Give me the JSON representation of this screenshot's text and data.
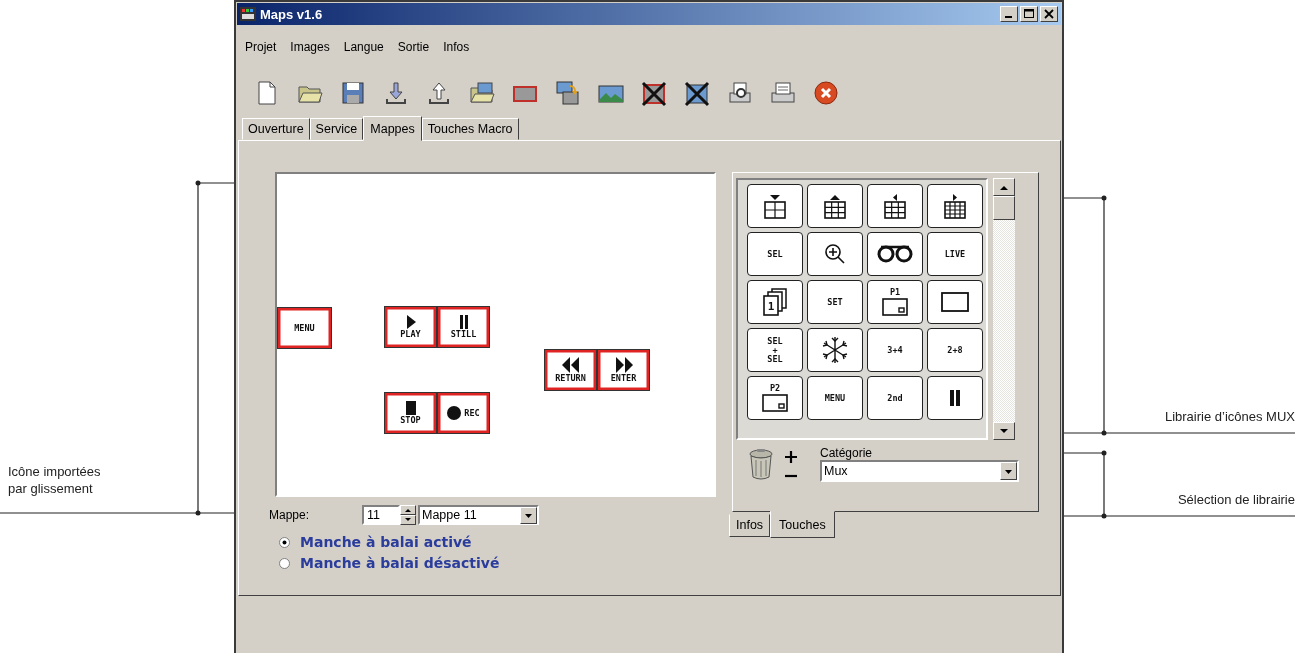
{
  "annotations": {
    "left": [
      "Icône importées par glissement"
    ],
    "right": [
      "Librairie d’icônes MUX",
      "Sélection de librairie"
    ]
  },
  "window": {
    "title": "Maps v1.6"
  },
  "menu": [
    "Projet",
    "Images",
    "Langue",
    "Sortie",
    "Infos"
  ],
  "tabs": [
    {
      "label": "Ouverture",
      "selected": false
    },
    {
      "label": "Service",
      "selected": false
    },
    {
      "label": "Mappes",
      "selected": true
    },
    {
      "label": "Touches Macro",
      "selected": false
    }
  ],
  "map_canvas": {
    "keys": [
      {
        "kind": "text",
        "label": "MENU"
      },
      {
        "kind": "play",
        "label": "PLAY"
      },
      {
        "kind": "still",
        "label": "STILL"
      },
      {
        "kind": "return",
        "label": "RETURN"
      },
      {
        "kind": "enter",
        "label": "ENTER"
      },
      {
        "kind": "stop",
        "label": "STOP"
      },
      {
        "kind": "rec",
        "label": "REC"
      }
    ]
  },
  "map_selector": {
    "label": "Mappe:",
    "number": "11",
    "name": "Mappe 11"
  },
  "joystick_options": [
    {
      "label": "Manche à balai activé",
      "selected": true
    },
    {
      "label": "Manche à balai désactivé",
      "selected": false
    }
  ],
  "library": {
    "keys": [
      {
        "kind": "grid-down"
      },
      {
        "kind": "grid-up"
      },
      {
        "kind": "grid-left"
      },
      {
        "kind": "grid-right"
      },
      {
        "kind": "text",
        "label": "SEL"
      },
      {
        "kind": "zoom"
      },
      {
        "kind": "tape"
      },
      {
        "kind": "text",
        "label": "LIVE"
      },
      {
        "kind": "pages",
        "label": "1"
      },
      {
        "kind": "text",
        "label": "SET"
      },
      {
        "kind": "pip",
        "label": "P1"
      },
      {
        "kind": "screen"
      },
      {
        "kind": "text",
        "label": "SEL + SEL"
      },
      {
        "kind": "freeze"
      },
      {
        "kind": "text",
        "label": "3+4"
      },
      {
        "kind": "text",
        "label": "2+8"
      },
      {
        "kind": "pip",
        "label": "P2"
      },
      {
        "kind": "text",
        "label": "MENU"
      },
      {
        "kind": "text",
        "label": "2nd"
      },
      {
        "kind": "pause"
      }
    ]
  },
  "category": {
    "label": "Catégorie",
    "value": "Mux"
  },
  "panel_tabs": [
    {
      "label": "Infos",
      "selected": false
    },
    {
      "label": "Touches",
      "selected": true
    }
  ]
}
